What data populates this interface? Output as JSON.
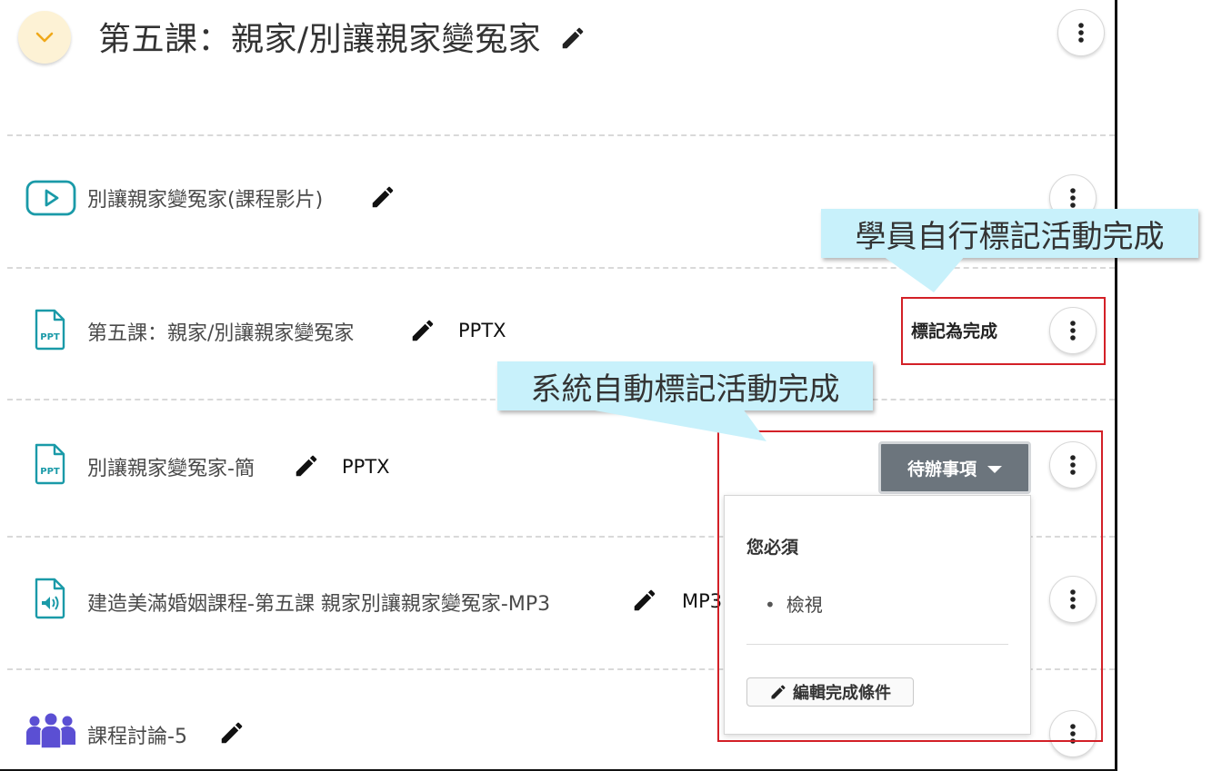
{
  "section": {
    "title": "第五課：親家/別讓親家變冤家"
  },
  "activities": [
    {
      "name": "別讓親家變冤家(課程影片)",
      "icon": "video-icon"
    },
    {
      "name": "第五課：親家/別讓親家變冤家",
      "type": "PPTX",
      "icon": "ppt-file-icon",
      "completion_label": "標記為完成"
    },
    {
      "name": "別讓親家變冤家-簡",
      "type": "PPTX",
      "icon": "ppt-file-icon"
    },
    {
      "name": "建造美滿婚姻課程-第五課 親家別讓親家變冤家-MP3",
      "type": "MP3",
      "icon": "audio-file-icon"
    },
    {
      "name": "課程討論-5",
      "icon": "forum-icon"
    }
  ],
  "todo": {
    "button_label": "待辦事項",
    "heading": "您必須",
    "items": [
      "檢視"
    ],
    "edit_label": "編輯完成條件"
  },
  "callouts": {
    "manual": "學員自行標記活動完成",
    "automatic": "系統自動標記活動完成"
  },
  "colors": {
    "icon_teal": "#1a9aa8",
    "forum_purple": "#5b4fd3",
    "callout_bg": "#c8f1fb",
    "highlight_red": "#d32027",
    "todo_button": "#6c757d"
  }
}
